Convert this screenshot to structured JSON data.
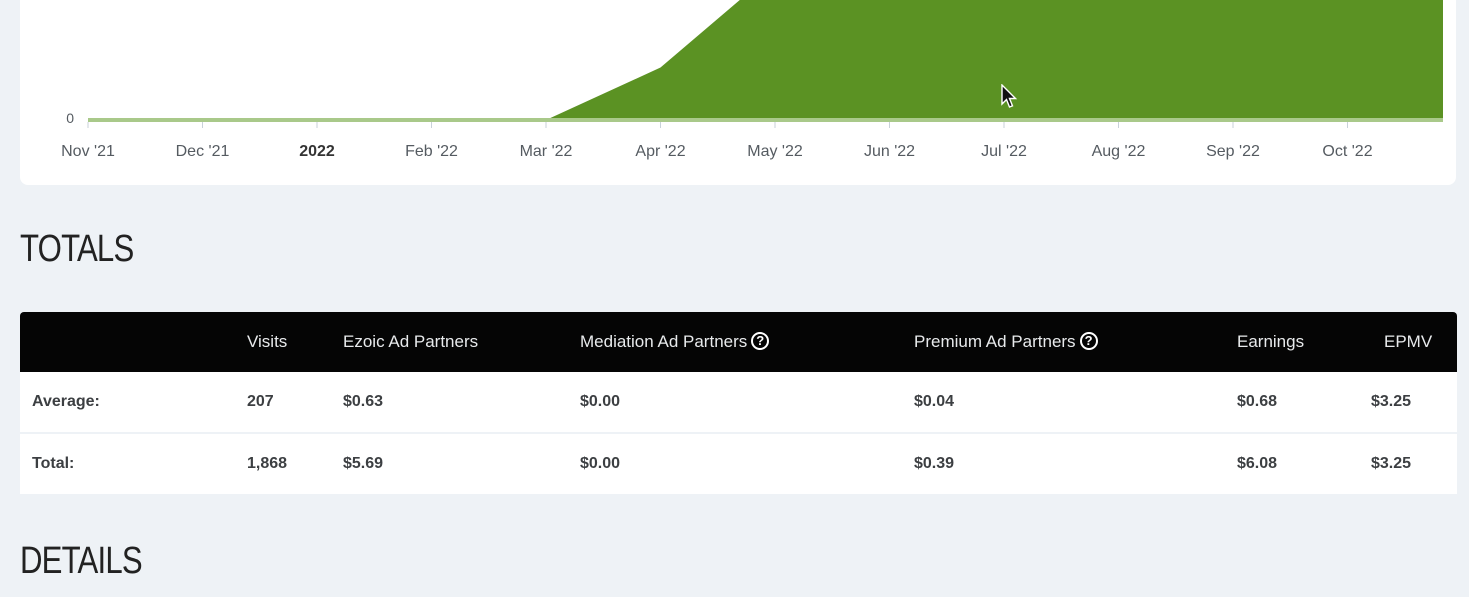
{
  "chart_data": {
    "type": "area",
    "x_ticks": [
      "Nov '21",
      "Dec '21",
      "2022",
      "Feb '22",
      "Mar '22",
      "Apr '22",
      "May '22",
      "Jun '22",
      "Jul '22",
      "Aug '22",
      "Sep '22",
      "Oct '22"
    ],
    "y_tick_labels": [
      "0"
    ],
    "series": [
      {
        "color": "#5b9223",
        "points": [
          {
            "x": "Nov '21",
            "y": 0
          },
          {
            "x": "Dec '21",
            "y": 0
          },
          {
            "x": "2022",
            "y": 0
          },
          {
            "x": "Feb '22",
            "y": 0
          },
          {
            "x": "Mar '22",
            "y": 0
          },
          {
            "x": "Apr '22",
            "y": 0.35
          },
          {
            "x": "May '22",
            "y": 1.0
          },
          {
            "x": "Jun '22",
            "y": 0.95
          },
          {
            "x": "Jul '22",
            "y": 1.0
          },
          {
            "x": "Aug '22",
            "y": 1.0
          },
          {
            "x": "Sep '22",
            "y": 1.0
          },
          {
            "x": "Oct '22",
            "y": 1.0
          }
        ]
      }
    ],
    "baseline_color": "#a9c98a",
    "grid": false
  },
  "totals": {
    "title": "TOTALS",
    "headers": [
      "",
      "Visits",
      "Ezoic Ad Partners",
      "Mediation Ad Partners",
      "Premium Ad Partners",
      "Earnings",
      "EPMV"
    ],
    "help_icon_glyph": "?",
    "rows": [
      {
        "label": "Average:",
        "visits": "207",
        "ezoic": "$0.63",
        "mediation": "$0.00",
        "premium": "$0.04",
        "earnings": "$0.68",
        "epmv": "$3.25"
      },
      {
        "label": "Total:",
        "visits": "1,868",
        "ezoic": "$5.69",
        "mediation": "$0.00",
        "premium": "$0.39",
        "earnings": "$6.08",
        "epmv": "$3.25"
      }
    ]
  },
  "details": {
    "title": "DETAILS"
  },
  "colors": {
    "page_bg": "#eef2f6",
    "header_bg": "#050505",
    "area_fill": "#5b9223"
  }
}
